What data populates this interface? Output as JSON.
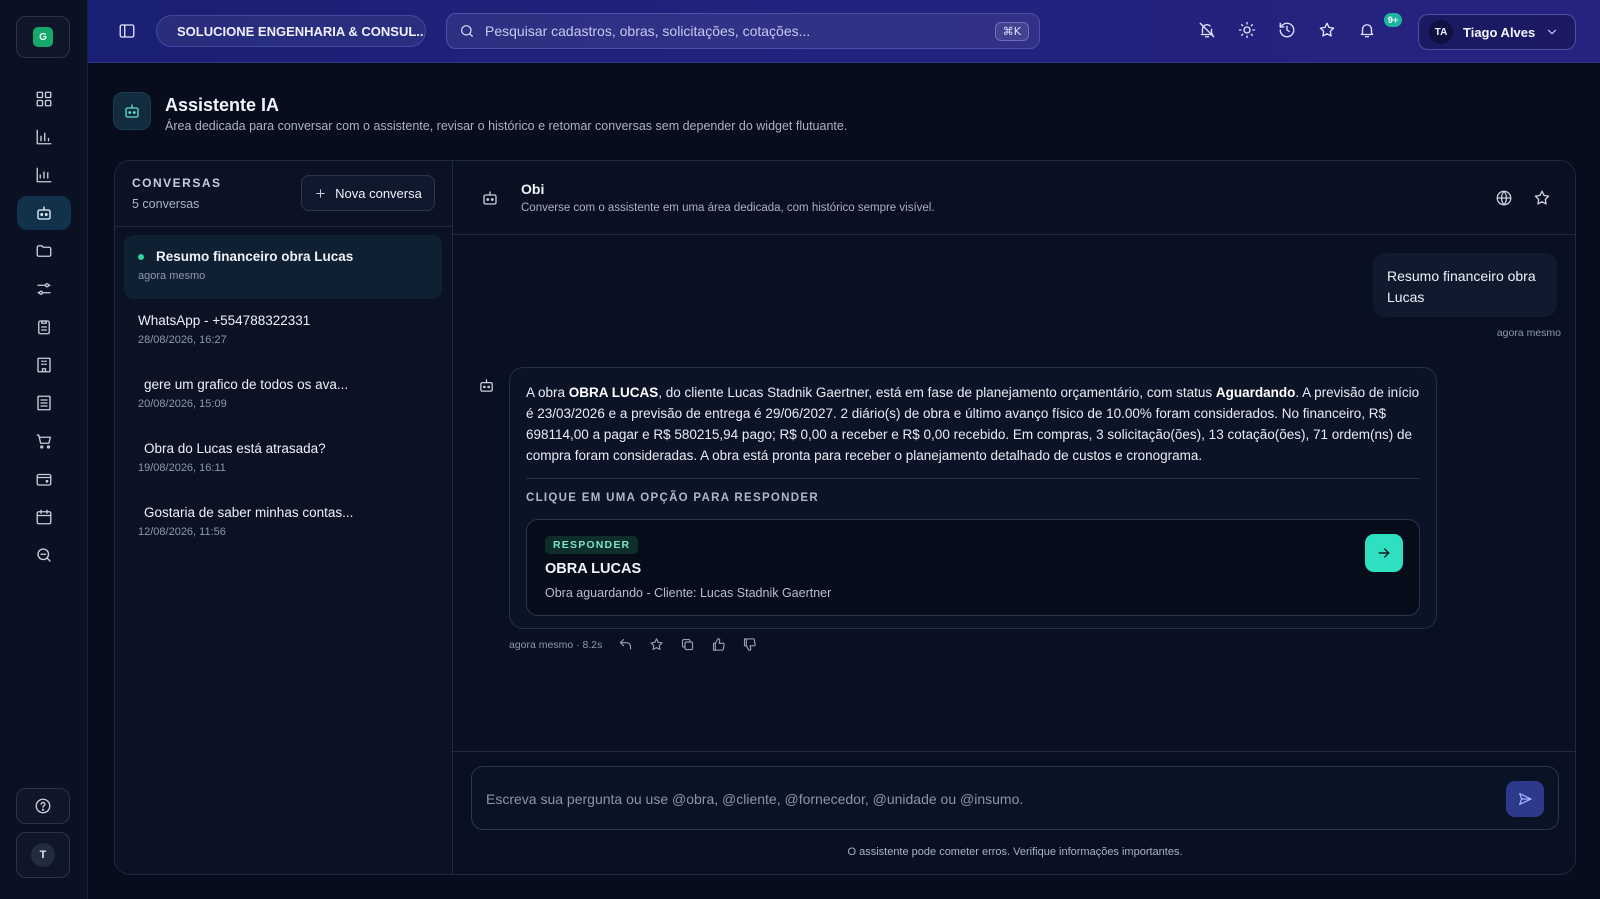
{
  "topbar": {
    "company": "SOLUCIONE ENGENHARIA & CONSUL...",
    "search_placeholder": "Pesquisar cadastros, obras, solicitações, cotações...",
    "search_shortcut": "⌘K",
    "notification_badge": "9+",
    "user": {
      "initials": "TA",
      "name": "Tiago Alves"
    }
  },
  "rail": {
    "brand_initial": "G",
    "user_initial": "T",
    "active_item": "assistant"
  },
  "page": {
    "title": "Assistente IA",
    "subtitle": "Área dedicada para conversar com o assistente, revisar o histórico e retomar conversas sem depender do widget flutuante."
  },
  "conversations": {
    "label": "CONVERSAS",
    "count": "5 conversas",
    "new_label": "Nova conversa",
    "items": [
      {
        "title": "Resumo financeiro obra Lucas",
        "time": "agora mesmo",
        "active": true
      },
      {
        "title": "WhatsApp - +554788322331",
        "time": "28/08/2026, 16:27"
      },
      {
        "title": "gere um grafico de todos os ava...",
        "time": "20/08/2026, 15:09"
      },
      {
        "title": "Obra do Lucas está atrasada?",
        "time": "19/08/2026, 16:11"
      },
      {
        "title": "Gostaria de saber minhas contas...",
        "time": "12/08/2026, 11:56"
      }
    ]
  },
  "chat": {
    "name": "Obi",
    "description": "Converse com o assistente em uma área dedicada, com histórico sempre visível.",
    "user_message": {
      "text": "Resumo financeiro obra Lucas",
      "time": "agora mesmo"
    },
    "bot_message": {
      "p1": "A obra ",
      "b1": "OBRA LUCAS",
      "p2": ", do cliente Lucas Stadnik Gaertner, está em fase de planejamento orçamentário, com status ",
      "b2": "Aguardando",
      "p3": ". A previsão de início é 23/03/2026 e a previsão de entrega é 29/06/2027. 2 diário(s) de obra e último avanço físico de 10.00% foram considerados. No financeiro, R$ 698114,00 a pagar e R$ 580215,94 pago; R$ 0,00 a receber e R$ 0,00 recebido. Em compras, 3 solicitação(ões), 13 cotação(ões), 71 ordem(ns) de compra foram consideradas. A obra está pronta para receber o planejamento detalhado de custos e cronograma.",
      "hint": "CLIQUE EM UMA OPÇÃO PARA RESPONDER",
      "option": {
        "tag": "RESPONDER",
        "title": "OBRA LUCAS",
        "subtitle": "Obra aguardando - Cliente: Lucas Stadnik Gaertner"
      },
      "meta": "agora mesmo · 8.2s"
    },
    "composer_placeholder": "Escreva sua pergunta ou use @obra, @cliente, @fornecedor, @unidade ou @insumo.",
    "disclaimer": "O assistente pode cometer erros. Verifique informações importantes."
  }
}
